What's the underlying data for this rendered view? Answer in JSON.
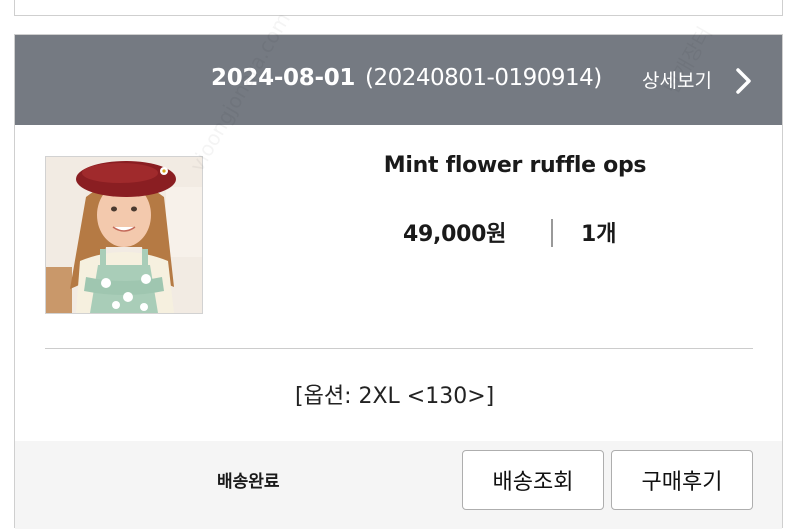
{
  "order": {
    "date": "2024-08-01",
    "order_number": "(20240801-0190914)",
    "detail_link": "상세보기"
  },
  "product": {
    "name": "Mint flower ruffle ops",
    "price": "49,000원",
    "separator": "|",
    "quantity": "1개",
    "option": "[옵션: 2XL <130>]"
  },
  "footer": {
    "status": "배송완료",
    "track_button": "배송조회",
    "review_button": "구매후기"
  },
  "watermarks": [
    "vioongjonara.com",
    "번개장터"
  ]
}
